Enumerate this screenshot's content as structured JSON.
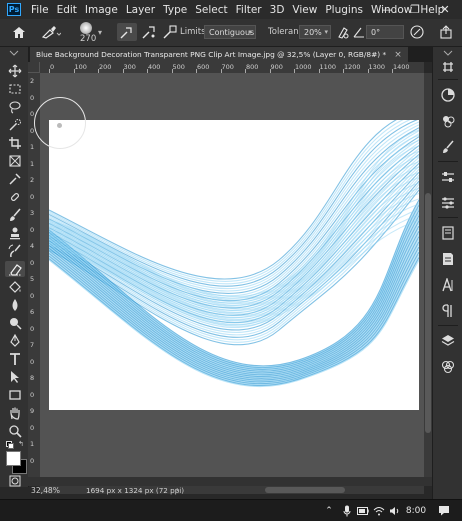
{
  "app": {
    "logo_text": "Ps"
  },
  "menu": [
    "File",
    "Edit",
    "Image",
    "Layer",
    "Type",
    "Select",
    "Filter",
    "3D",
    "View",
    "Plugins",
    "Window",
    "Help"
  ],
  "window_controls": {
    "minimize": "—",
    "restore": "❐",
    "close": "✕"
  },
  "options_bar": {
    "brush_size": "270",
    "limits_label": "Limits:",
    "limits_value": "Contiguous",
    "tolerance_label": "Tolerance:",
    "tolerance_value": "20%",
    "angle_value": "0°"
  },
  "document_tab": {
    "title": "Blue Background Decoration Transparent PNG Clip Art Image.jpg @ 32,5% (Layer 0, RGB/8#) *",
    "close_glyph": "×"
  },
  "ruler_top_ticks": [
    "0",
    "100",
    "200",
    "300",
    "400",
    "500",
    "600",
    "700",
    "800",
    "900",
    "1000",
    "1100",
    "1200",
    "1300",
    "1400"
  ],
  "ruler_left_ticks": [
    "2",
    "0",
    "0",
    "0",
    "1",
    "1",
    "2",
    "0",
    "3",
    "0",
    "4",
    "0",
    "5",
    "0",
    "6",
    "0",
    "7",
    "0",
    "8",
    "0",
    "9",
    "0",
    "1",
    "0"
  ],
  "tools": [
    "move-tool-icon",
    "marquee-tool-icon",
    "lasso-tool-icon",
    "quick-select-tool-icon",
    "crop-tool-icon",
    "frame-tool-icon",
    "eyedropper-tool-icon",
    "healing-brush-tool-icon",
    "brush-tool-icon",
    "clone-stamp-tool-icon",
    "history-brush-tool-icon",
    "background-eraser-tool-icon",
    "paint-bucket-tool-icon",
    "blur-tool-icon",
    "dodge-tool-icon",
    "pen-tool-icon",
    "type-tool-icon",
    "path-select-tool-icon",
    "rectangle-tool-icon",
    "hand-tool-icon",
    "zoom-tool-icon"
  ],
  "active_tool": "background-eraser-tool-icon",
  "colors": {
    "foreground": "#ffffff",
    "background": "#000000",
    "accent": "#31a8ff",
    "wave_light": "#8fd3f4",
    "wave_dark": "#1e8fd0"
  },
  "right_panel_icons": [
    "libraries-icon",
    "color-icon",
    "swatches-icon",
    "brushes-icon",
    "adjustments-icon",
    "properties-icon",
    "learn-icon",
    "notes-icon",
    "character-icon",
    "paragraph-icon",
    "layers-icon",
    "channels-icon"
  ],
  "status": {
    "zoom": "32,48%",
    "doc_info": "1694 px x 1324 px (72 ppi)",
    "arrow": "›"
  },
  "taskbar": {
    "time": "8:00"
  }
}
